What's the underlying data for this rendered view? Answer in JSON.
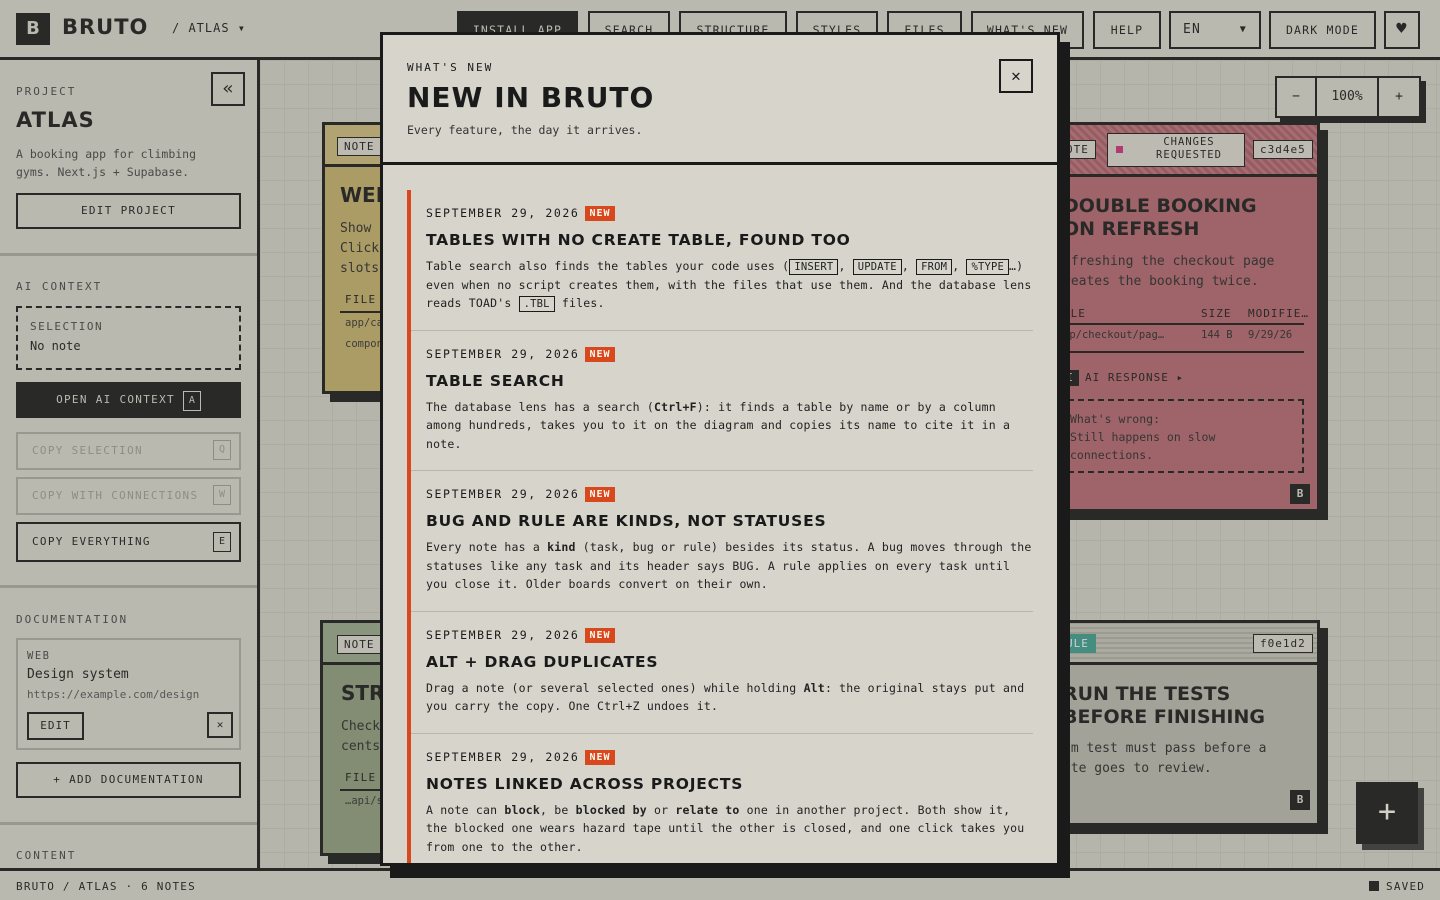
{
  "header": {
    "logo_letter": "B",
    "brand": "BRUTO",
    "breadcrumb": "/ ATLAS ▾",
    "buttons": {
      "install": "INSTALL APP",
      "search": "SEARCH",
      "structure": "STRUCTURE",
      "styles": "STYLES",
      "files": "FILES",
      "whats_new": "WHAT'S NEW",
      "help": "HELP",
      "language": "EN",
      "dark_mode": "DARK MODE"
    },
    "heart_icon": "♥"
  },
  "sidebar": {
    "project_label": "PROJECT",
    "collapse_icon": "«",
    "project_name": "ATLAS",
    "project_desc": "A booking app for climbing gyms. Next.js + Supabase.",
    "edit_project": "EDIT PROJECT",
    "ai_context_label": "AI CONTEXT",
    "selection_label": "SELECTION",
    "selection_value": "No note",
    "open_ai_context": "OPEN AI CONTEXT",
    "open_ai_key": "A",
    "copy_selection": "COPY SELECTION",
    "copy_selection_key": "Q",
    "copy_connections": "COPY WITH CONNECTIONS",
    "copy_connections_key": "W",
    "copy_everything": "COPY EVERYTHING",
    "copy_everything_key": "E",
    "documentation_label": "DOCUMENTATION",
    "doc": {
      "kind": "WEB",
      "name": "Design system",
      "url": "https://example.com/design",
      "edit": "EDIT",
      "remove_icon": "✕"
    },
    "add_documentation": "+ ADD DOCUMENTATION",
    "content_label": "CONTENT"
  },
  "canvas": {
    "zoom": {
      "minus": "−",
      "value": "100%",
      "plus": "+"
    },
    "card_left_top": {
      "tag": "NOTE",
      "title": "WEL",
      "line1": "Show",
      "line2": "Click",
      "line3": "slots",
      "file_label": "FILE",
      "file1": "app/ca",
      "file2": "compon"
    },
    "card_left_bottom": {
      "tag": "NOTE",
      "title": "STR",
      "line1": "Check",
      "line2": "cents",
      "file_label": "FILE",
      "file1": "…api/s"
    },
    "card_right_top": {
      "tag": "OTE",
      "status": "CHANGES REQUESTED",
      "hash": "c3d4e5",
      "title_line1": "DOUBLE BOOKING",
      "title_line2": "ON REFRESH",
      "desc_line1": "efreshing the checkout page",
      "desc_line2": "reates the booking twice.",
      "col_file": "ILE",
      "col_size": "SIZE",
      "col_modified": "MODIFIE…",
      "row_file": "pp/checkout/pag…",
      "row_size": "144 B",
      "row_modified": "9/29/26",
      "ai_key": "I",
      "ai_response": "AI RESPONSE ▸",
      "wrong_label": "What's wrong:",
      "wrong_line1": "Still happens on slow",
      "wrong_line2": "connections.",
      "footer_badge": "B"
    },
    "card_right_bottom": {
      "tag": "ULE",
      "hash": "f0e1d2",
      "title_line1": "RUN THE TESTS",
      "title_line2": "BEFORE FINISHING",
      "desc_line1": "om test must pass before a",
      "desc_line2": "ote goes to review.",
      "footer_badge": "B"
    },
    "fab": "+"
  },
  "footer": {
    "left": "BRUTO / ATLAS · 6 NOTES",
    "right": "SAVED"
  },
  "modal": {
    "kicker": "WHAT'S NEW",
    "title": "NEW IN BRUTO",
    "subtitle": "Every feature, the day it arrives.",
    "close_icon": "✕",
    "entries": [
      {
        "date": "SEPTEMBER 29, 2026",
        "badge": "NEW",
        "title": "TABLES WITH NO CREATE TABLE, FOUND TOO",
        "p1": "Table search also finds the tables your code uses (",
        "c1": "INSERT",
        "s1": ", ",
        "c2": "UPDATE",
        "s2": ", ",
        "c3": "FROM",
        "s3": ", ",
        "c4": "%TYPE",
        "p2": "…) even when no script creates them, with the files that use them. And the database lens reads TOAD's ",
        "c5": ".TBL",
        "p3": " files."
      },
      {
        "date": "SEPTEMBER 29, 2026",
        "badge": "NEW",
        "title": "TABLE SEARCH",
        "p1": "The database lens has a search (",
        "b1": "Ctrl+F",
        "p2": "): it finds a table by name or by a column among hundreds, takes you to it on the diagram and copies its name to cite it in a note."
      },
      {
        "date": "SEPTEMBER 29, 2026",
        "badge": "NEW",
        "title": "BUG AND RULE ARE KINDS, NOT STATUSES",
        "p1": "Every note has a ",
        "b1": "kind",
        "p2": " (task, bug or rule) besides its status. A bug moves through the statuses like any task and its header says BUG. A rule applies on every task until you close it. Older boards convert on their own."
      },
      {
        "date": "SEPTEMBER 29, 2026",
        "badge": "NEW",
        "title": "ALT + DRAG DUPLICATES",
        "p1": "Drag a note (or several selected ones) while holding ",
        "b1": "Alt",
        "p2": ": the original stays put and you carry the copy. One Ctrl+Z undoes it."
      },
      {
        "date": "SEPTEMBER 29, 2026",
        "badge": "NEW",
        "title": "NOTES LINKED ACROSS PROJECTS",
        "p1": "A note can ",
        "b1": "block",
        "p2": ", be ",
        "b2": "blocked by",
        "p3": " or ",
        "b3": "relate to",
        "p4": " one in another project. Both show it, the blocked one wears hazard tape until the other is closed, and one click takes you from one to the other."
      }
    ]
  },
  "colors": {
    "ink": "#1a1a1a",
    "paper": "#d4d2c8",
    "accent": "#d9481c",
    "card_yellow": "#c1ad6b",
    "card_green": "#8c9a7c",
    "card_red": "#b06670",
    "card_rule": "#b7b5ab",
    "rule_tag": "#3d9a8b",
    "status_pink": "#c9307a"
  }
}
